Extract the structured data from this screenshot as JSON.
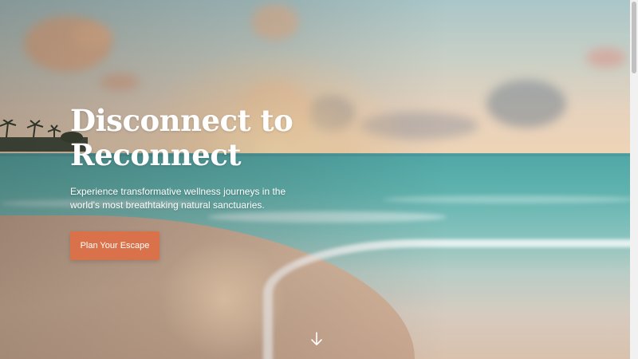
{
  "hero": {
    "title_line1": "Disconnect to",
    "title_line2": "Reconnect",
    "subtitle": "Experience transformative wellness journeys in the world's most breathtaking natural sanctuaries.",
    "cta_label": "Plan Your Escape",
    "scroll_icon": "arrow-down-icon",
    "background": "beach-sunset-image"
  },
  "colors": {
    "cta_background": "#d9714a",
    "title_text": "#ffffff",
    "subtitle_text": "#ffffff"
  }
}
